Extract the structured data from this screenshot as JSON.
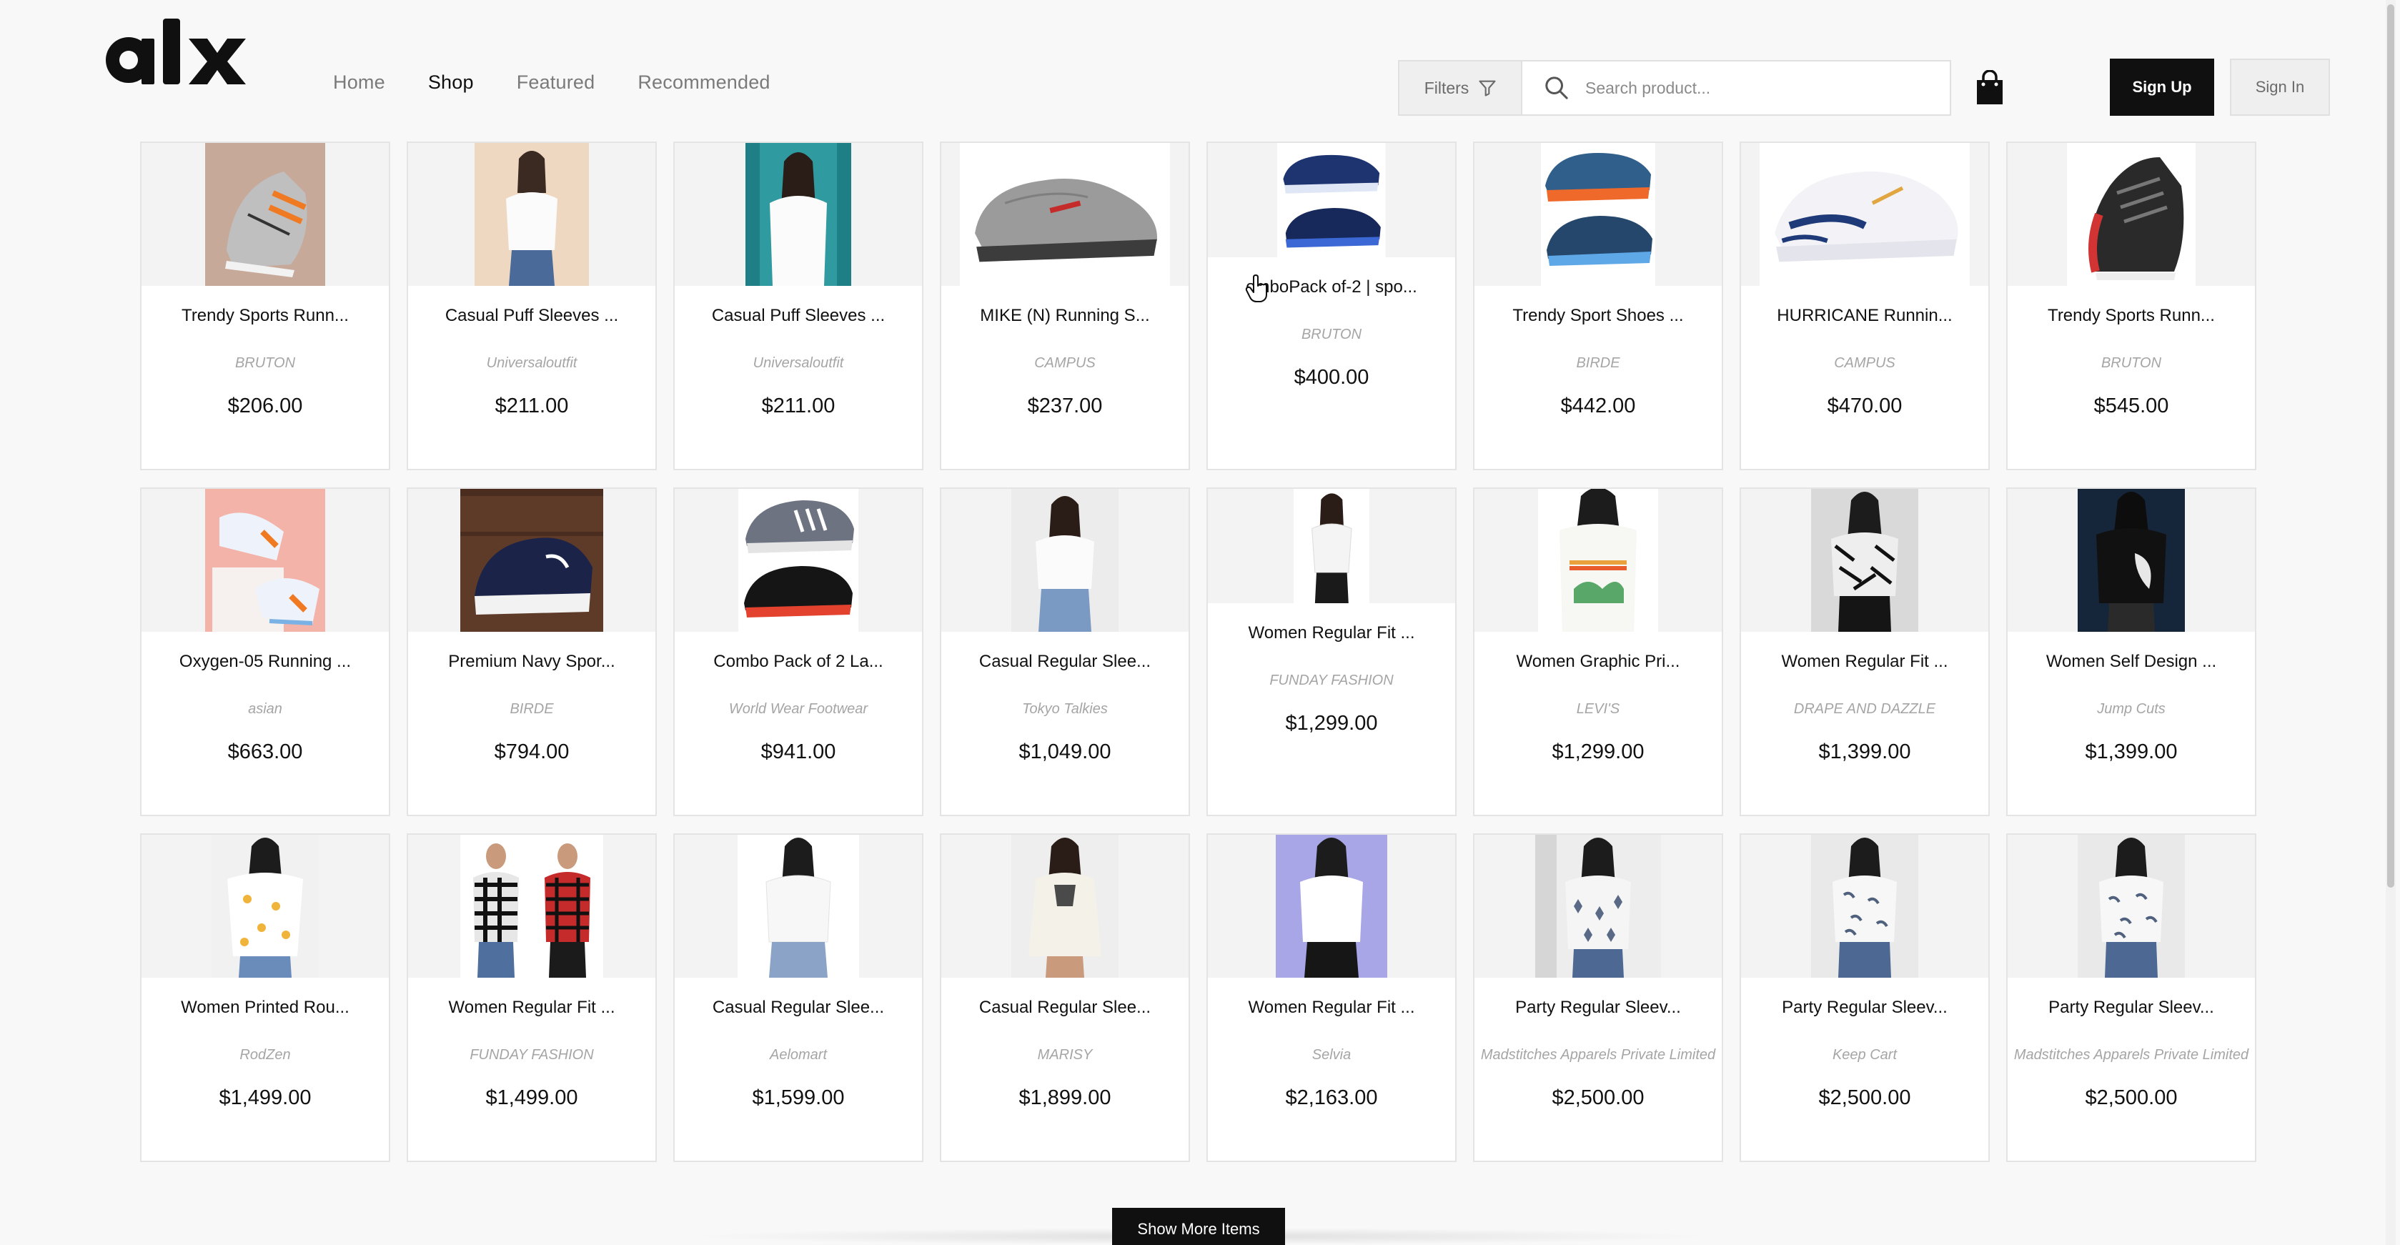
{
  "brand": {
    "logo_text": "alx"
  },
  "nav": {
    "items": [
      "Home",
      "Shop",
      "Featured",
      "Recommended"
    ],
    "active": "Shop"
  },
  "toolbar": {
    "filters_label": "Filters",
    "filters_icon": "filter-funnel-icon",
    "search_placeholder": "Search product...",
    "search_icon": "search-icon",
    "cart_icon": "shopping-bag-icon",
    "signup_label": "Sign Up",
    "signin_label": "Sign In"
  },
  "colors": {
    "primary": "#101010",
    "background": "#f8f8f8",
    "muted_text": "#a5a5a5"
  },
  "products": [
    {
      "name": "Trendy Sports Runn...",
      "brand": "BRUTON",
      "price": "$206.00",
      "image": "shoe-grey-orange"
    },
    {
      "name": "Casual Puff Sleeves ...",
      "brand": "Universaloutfit",
      "price": "$211.00",
      "image": "woman-white-top-beige"
    },
    {
      "name": "Casual Puff Sleeves ...",
      "brand": "Universaloutfit",
      "price": "$211.00",
      "image": "woman-white-top-teal"
    },
    {
      "name": "MIKE (N) Running S...",
      "brand": "CAMPUS",
      "price": "$237.00",
      "image": "shoe-grey-red"
    },
    {
      "name": "omboPack of-2 | spo...",
      "brand": "BRUTON",
      "price": "$400.00",
      "image": "shoes-navy-pair"
    },
    {
      "name": "Trendy Sport Shoes ...",
      "brand": "BIRDE",
      "price": "$442.00",
      "image": "shoes-blue-orange-pair"
    },
    {
      "name": "HURRICANE Runnin...",
      "brand": "CAMPUS",
      "price": "$470.00",
      "image": "shoe-white-blue"
    },
    {
      "name": "Trendy Sports Runn...",
      "brand": "BRUTON",
      "price": "$545.00",
      "image": "shoe-black-red"
    },
    {
      "name": "Oxygen-05 Running ...",
      "brand": "asian",
      "price": "$663.00",
      "image": "shoe-white-orange-pink"
    },
    {
      "name": "Premium Navy Spor...",
      "brand": "BIRDE",
      "price": "$794.00",
      "image": "shoe-navy-wood"
    },
    {
      "name": "Combo Pack of 2 La...",
      "brand": "World Wear Footwear",
      "price": "$941.00",
      "image": "shoes-grey-black-pair"
    },
    {
      "name": "Casual Regular Slee...",
      "brand": "Tokyo Talkies",
      "price": "$1,049.00",
      "image": "woman-white-blouse"
    },
    {
      "name": "Women Regular Fit ...",
      "brand": "FUNDAY FASHION",
      "price": "$1,299.00",
      "image": "woman-white-shirt"
    },
    {
      "name": "Women Graphic Pri...",
      "brand": "LEVI'S",
      "price": "$1,299.00",
      "image": "woman-graphic-tee"
    },
    {
      "name": "Women Regular Fit ...",
      "brand": "DRAPE AND DAZZLE",
      "price": "$1,399.00",
      "image": "woman-zebra-shirt"
    },
    {
      "name": "Women Self Design ...",
      "brand": "Jump Cuts",
      "price": "$1,399.00",
      "image": "woman-black-top"
    },
    {
      "name": "Women Printed Rou...",
      "brand": "RodZen",
      "price": "$1,499.00",
      "image": "woman-printed-tee"
    },
    {
      "name": "Women Regular Fit ...",
      "brand": "FUNDAY FASHION",
      "price": "$1,499.00",
      "image": "women-check-shirts"
    },
    {
      "name": "Casual Regular Slee...",
      "brand": "Aelomart",
      "price": "$1,599.00",
      "image": "woman-white-top-jeans"
    },
    {
      "name": "Casual Regular Slee...",
      "brand": "MARISY",
      "price": "$1,899.00",
      "image": "woman-white-tunic"
    },
    {
      "name": "Women Regular Fit ...",
      "brand": "Selvia",
      "price": "$2,163.00",
      "image": "woman-white-shirt-lavender"
    },
    {
      "name": "Party Regular Sleev...",
      "brand": "Madstitches Apparels Private Limited",
      "price": "$2,500.00",
      "image": "woman-print-top-1"
    },
    {
      "name": "Party Regular Sleev...",
      "brand": "Keep Cart",
      "price": "$2,500.00",
      "image": "woman-print-top-2"
    },
    {
      "name": "Party Regular Sleev...",
      "brand": "Madstitches Apparels Private Limited",
      "price": "$2,500.00",
      "image": "woman-print-top-3"
    }
  ],
  "footer": {
    "show_more_label": "Show More Items"
  }
}
